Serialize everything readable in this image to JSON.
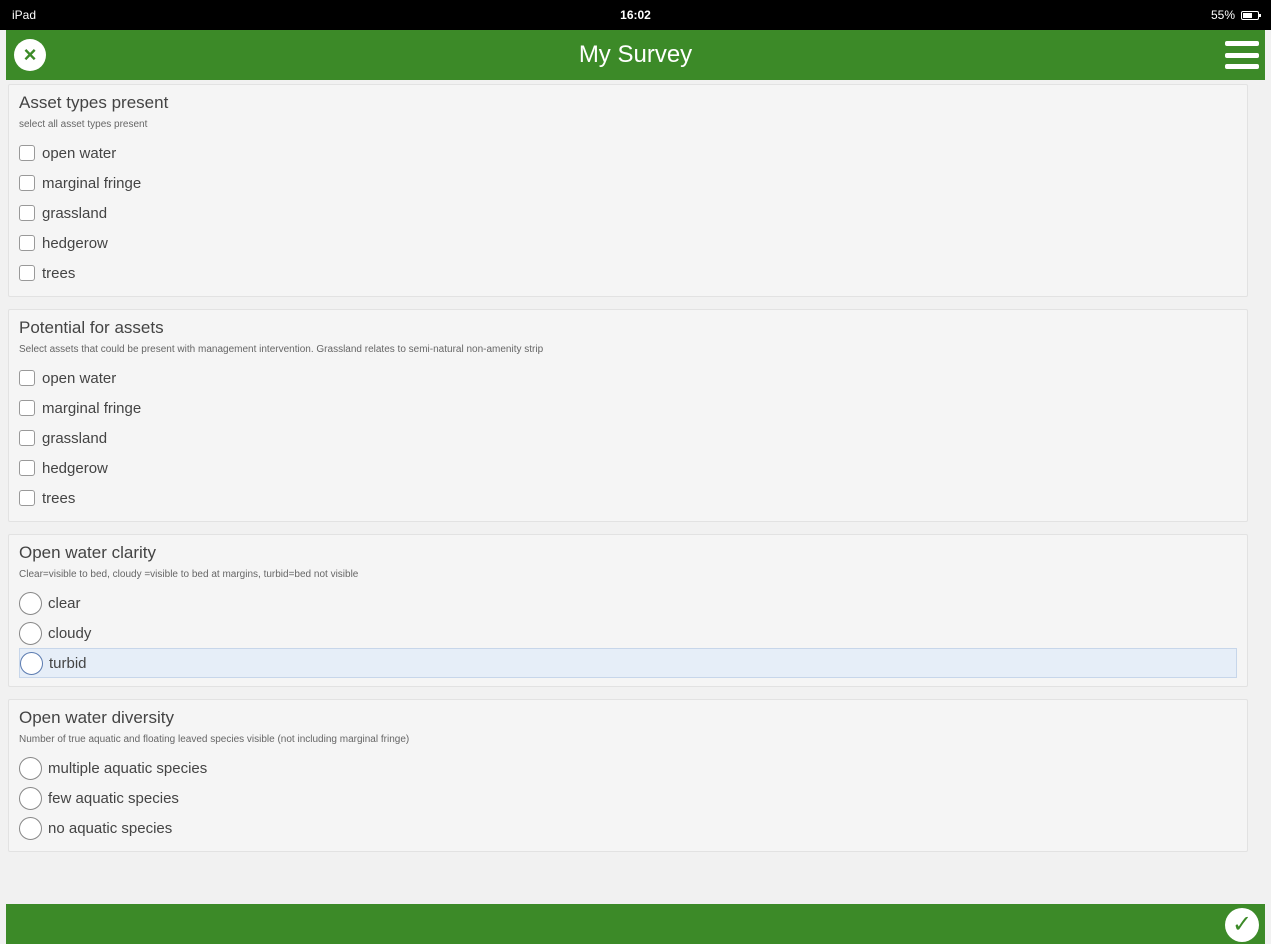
{
  "status_bar": {
    "device": "iPad",
    "time": "16:02",
    "battery": "55%"
  },
  "header": {
    "title": "My Survey",
    "close_icon": "×",
    "menu_icon": "hamburger-menu"
  },
  "sections": {
    "asset_types": {
      "title": "Asset types present",
      "hint": "select all asset types present",
      "options": [
        "open water",
        "marginal fringe",
        "grassland",
        "hedgerow",
        "trees"
      ]
    },
    "potential": {
      "title": "Potential for assets",
      "hint": "Select assets that could be present with management intervention. Grassland relates to semi-natural non-amenity strip",
      "options": [
        "open water",
        "marginal fringe",
        "grassland",
        "hedgerow",
        "trees"
      ]
    },
    "clarity": {
      "title": "Open water clarity",
      "hint": "Clear=visible to bed, cloudy =visible to bed at margins, turbid=bed not visible",
      "options": [
        "clear",
        "cloudy",
        "turbid"
      ]
    },
    "diversity": {
      "title": "Open water diversity",
      "hint": "Number of true aquatic and floating leaved species visible (not including marginal fringe)",
      "options": [
        "multiple aquatic species",
        "few aquatic species",
        "no aquatic species"
      ]
    }
  },
  "footer": {
    "submit_icon": "✓"
  },
  "colors": {
    "brand_green": "#3c8a28",
    "highlight": "#e6eef8"
  }
}
